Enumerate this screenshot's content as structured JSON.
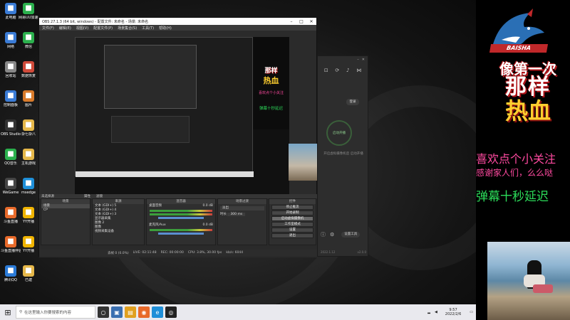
{
  "desktop": {
    "icons": [
      {
        "label": "此电脑",
        "icon": "computer-icon",
        "color": "#3a7bd5"
      },
      {
        "label": "网易UU加速器",
        "icon": "uu-icon",
        "color": "#2bb04d"
      },
      {
        "label": "网络",
        "icon": "network-icon",
        "color": "#3a7bd5"
      },
      {
        "label": "微信",
        "icon": "wechat-icon",
        "color": "#2bb04d"
      },
      {
        "label": "回收站",
        "icon": "recycle-bin-icon",
        "color": "#888888"
      },
      {
        "label": "数据恢复",
        "icon": "data-recovery-icon",
        "color": "#d04a3a"
      },
      {
        "label": "控制面板",
        "icon": "control-panel-icon",
        "color": "#3a7bd5"
      },
      {
        "label": "图片",
        "icon": "pictures-icon",
        "color": "#d97b2b"
      },
      {
        "label": "OBS Studio",
        "icon": "obs-icon",
        "color": "#333333"
      },
      {
        "label": "杂七杂八",
        "icon": "folder-icon",
        "color": "#e6b84a"
      },
      {
        "label": "QQ音乐",
        "icon": "qq-music-icon",
        "color": "#2bb04d"
      },
      {
        "label": "主机游戏",
        "icon": "folder-icon",
        "color": "#e6b84a"
      },
      {
        "label": "WeGame",
        "icon": "wegame-icon",
        "color": "#444444"
      },
      {
        "label": "msedge",
        "icon": "edge-icon",
        "color": "#1f8fd8"
      },
      {
        "label": "斗鱼直播",
        "icon": "douyu-icon",
        "color": "#e86a2a"
      },
      {
        "label": "YY开播",
        "icon": "yy-icon",
        "color": "#f0b400"
      },
      {
        "label": "斗鱼直播伴侣",
        "icon": "douyu-helper-icon",
        "color": "#e86a2a"
      },
      {
        "label": "YY开播",
        "icon": "yy-icon",
        "color": "#f0b400"
      },
      {
        "label": "腾讯QQ",
        "icon": "qq-icon",
        "color": "#2b7bd8"
      },
      {
        "label": "已建",
        "icon": "folder-icon",
        "color": "#e6b84a"
      }
    ]
  },
  "taskbar": {
    "search_placeholder": "在这里输入你要搜索的内容",
    "time": "9:57",
    "date": "2022/2/6"
  },
  "obs": {
    "title": "OBS 27.1.3 (64 bit, windows) - 配置文件: 未命名 - 场景: 未命名",
    "menu": [
      "文件(F)",
      "编辑(E)",
      "视图(V)",
      "配置文件(P)",
      "场景集合(S)",
      "工具(T)",
      "帮助(H)"
    ],
    "dock_bar": "未选择源",
    "props_btn": "属性",
    "filters_btn": "滤镜",
    "panels": {
      "scenes": {
        "title": "场景",
        "items": [
          "场景",
          "CP"
        ]
      },
      "sources": {
        "title": "来源",
        "items": [
          "文本 (GDI+) 5",
          "文本 (GDI+) 4",
          "文本 (GDI+) 3",
          "显示器采集",
          "图像 2",
          "图像",
          "视频采集设备"
        ]
      },
      "mixer": {
        "title": "混音器",
        "items": [
          "桌面音频",
          "麦克风/Aux"
        ],
        "db": "0.0 dB"
      },
      "transitions": {
        "title": "场景过渡",
        "type": "淡出",
        "duration_label": "时长",
        "duration": "300 ms"
      },
      "controls": {
        "title": "控件",
        "buttons": [
          "停止推流",
          "开始录制",
          "启动虚拟摄像机",
          "工作室模式",
          "设置",
          "退出"
        ]
      }
    },
    "status": [
      "丢帧 0 (0.0%)",
      "LIVE: 02:11:48",
      "REC: 00:00:00",
      "CPU: 3.8%, 30.00 fps",
      "kb/s: 6044"
    ]
  },
  "side_panel": {
    "login_btn": "登录",
    "start_btn": "启动开播",
    "note": "开启虚拟摄像机后 启动开播",
    "settings_btn": "设置工具",
    "version_left": "2022.1.12",
    "version_right": "v2.0.0"
  },
  "overlay": {
    "brand": "BAISHA",
    "slogan_line1": "像第一次",
    "slogan_line2": "那样",
    "slogan_line3": "热血",
    "follow_text": "喜欢点个小关注",
    "thanks_text": "感谢家人们，么么哒",
    "delay_text": "弹幕十秒延迟"
  }
}
